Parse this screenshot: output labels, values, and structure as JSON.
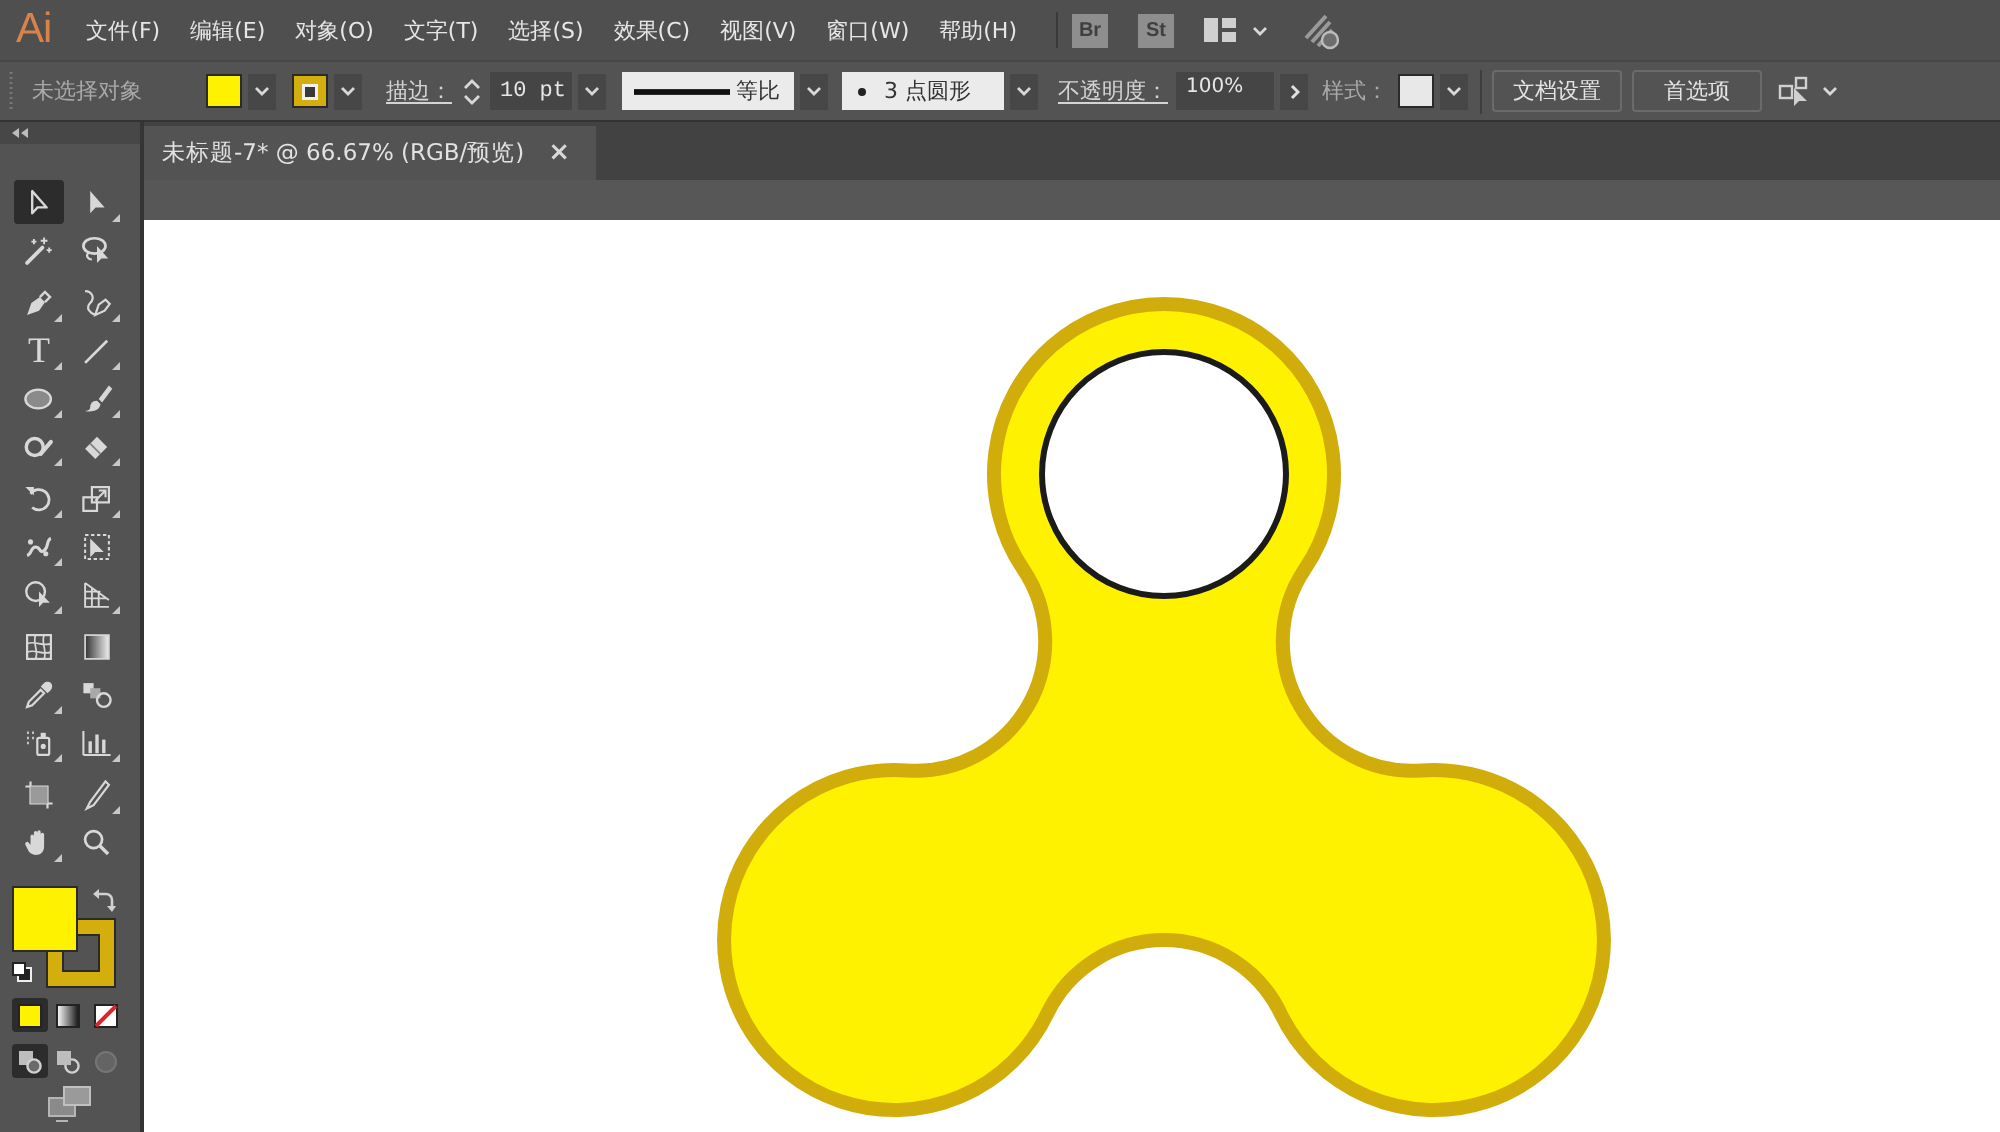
{
  "menu_bar": {
    "logo": "Ai",
    "menus": [
      "文件(F)",
      "编辑(E)",
      "对象(O)",
      "文字(T)",
      "选择(S)",
      "效果(C)",
      "视图(V)",
      "窗口(W)",
      "帮助(H)"
    ],
    "apps": [
      "Br",
      "St"
    ]
  },
  "control_bar": {
    "selection": "未选择对象",
    "swatches": [
      {
        "kind": "fill",
        "color": "#fff200"
      },
      {
        "kind": "stroke",
        "color": "#d4ae0c"
      }
    ],
    "stroke_label": "描边：",
    "stroke_weight": "10 pt",
    "profile": "等比",
    "brush": "3 点圆形",
    "opacity_label": "不透明度：",
    "opacity": "100%",
    "style_label": "样式：",
    "buttons": [
      "文档设置",
      "首选项"
    ]
  },
  "toolbar": {
    "tool_groups": [
      {
        "tools": [
          {
            "kind": "select",
            "selected": true,
            "flyout": false
          },
          {
            "kind": "direct",
            "selected": false,
            "flyout": true
          },
          {
            "kind": "wand",
            "selected": false,
            "flyout": false
          },
          {
            "kind": "lasso",
            "selected": false,
            "flyout": false
          }
        ]
      },
      {
        "tools": [
          {
            "kind": "pen",
            "selected": false,
            "flyout": true
          },
          {
            "kind": "curvature",
            "selected": false,
            "flyout": true
          },
          {
            "kind": "type",
            "glyph": "T",
            "selected": false,
            "flyout": true
          },
          {
            "kind": "line",
            "selected": false,
            "flyout": true
          },
          {
            "kind": "ellipse",
            "selected": false,
            "flyout": true
          },
          {
            "kind": "brush",
            "selected": false,
            "flyout": true
          },
          {
            "kind": "shaper",
            "selected": false,
            "flyout": true
          },
          {
            "kind": "eraser",
            "selected": false,
            "flyout": true
          }
        ]
      },
      {
        "tools": [
          {
            "kind": "rotate",
            "selected": false,
            "flyout": true
          },
          {
            "kind": "scale",
            "selected": false,
            "flyout": true
          },
          {
            "kind": "warp",
            "selected": false,
            "flyout": true
          },
          {
            "kind": "transform",
            "selected": false,
            "flyout": false
          },
          {
            "kind": "builder",
            "selected": false,
            "flyout": true
          },
          {
            "kind": "perspective",
            "selected": false,
            "flyout": true
          }
        ]
      },
      {
        "tools": [
          {
            "kind": "mesh",
            "selected": false,
            "flyout": false
          },
          {
            "kind": "gradient",
            "selected": false,
            "flyout": false
          },
          {
            "kind": "eyedropper",
            "selected": false,
            "flyout": true
          },
          {
            "kind": "blend",
            "selected": false,
            "flyout": false
          },
          {
            "kind": "sprayer",
            "selected": false,
            "flyout": true
          },
          {
            "kind": "graph",
            "selected": false,
            "flyout": true
          }
        ]
      },
      {
        "tools": [
          {
            "kind": "artboard",
            "selected": false,
            "flyout": false
          },
          {
            "kind": "slice",
            "selected": false,
            "flyout": true
          },
          {
            "kind": "hand",
            "selected": false,
            "flyout": true
          },
          {
            "kind": "zoom",
            "selected": false,
            "flyout": false
          }
        ]
      }
    ],
    "fill_stroke": [
      {
        "kind": "fill",
        "color": "#fff200"
      },
      {
        "kind": "stroke",
        "color": "#d4ae0c"
      }
    ],
    "color_modes": [
      {
        "kind": "color",
        "selected": true
      },
      {
        "kind": "gradient",
        "selected": false
      },
      {
        "kind": "none",
        "selected": false
      }
    ],
    "draw_modes": [
      {
        "kind": "normal",
        "selected": true,
        "disabled": false
      },
      {
        "kind": "behind",
        "selected": false,
        "disabled": false
      },
      {
        "kind": "inside",
        "selected": false,
        "disabled": true
      }
    ]
  },
  "document_tab": {
    "title": "未标题-7* @ 66.67% (RGB/预览)",
    "close": "×"
  }
}
